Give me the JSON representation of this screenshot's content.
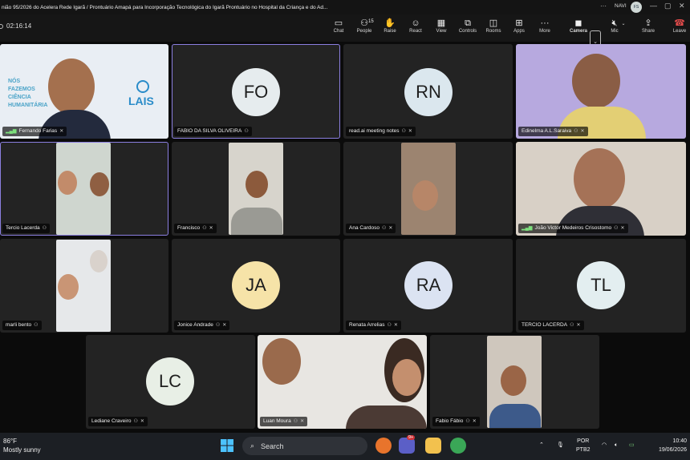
{
  "window": {
    "title": "nião 95/2026 do Acelera Rede Igarã / Prontuário Amapá para Incorporação Tecnológica do Igarã Prontuário no Hospital da Criança e do Ad...",
    "user_name": "NAVI",
    "avatar_initials": "FS"
  },
  "toolbar": {
    "timer": "02:16:14",
    "chat": "Chat",
    "people": "People",
    "people_count": "15",
    "raise": "Raise",
    "react": "React",
    "view": "View",
    "controls": "Controls",
    "rooms": "Rooms",
    "apps": "Apps",
    "more": "More",
    "camera": "Camera",
    "mic": "Mic",
    "share": "Share",
    "leave": "Leave"
  },
  "participants": [
    {
      "name": "Fernando Farias",
      "initials": "",
      "banner_lines": [
        "NÓS",
        "FAZEMOS",
        "CIÊNCIA",
        "HUMANITÁRIA"
      ],
      "logo": "LAIS"
    },
    {
      "name": "FABIO DA SILVA OLIVEIRA",
      "initials": "FO"
    },
    {
      "name": "read.ai meeting notes",
      "initials": "RN"
    },
    {
      "name": "Edinelma A.L.Saraiva",
      "initials": ""
    },
    {
      "name": "Tercio Lacerda",
      "initials": ""
    },
    {
      "name": "Francisco",
      "initials": ""
    },
    {
      "name": "Ana Cardoso",
      "initials": ""
    },
    {
      "name": "João Victor Medeiros Crisostomo",
      "initials": ""
    },
    {
      "name": "marli bento",
      "initials": ""
    },
    {
      "name": "Jonice Andrade",
      "initials": "JA"
    },
    {
      "name": "Renata Arrelias",
      "initials": "RA"
    },
    {
      "name": "TERCIO LACERDA",
      "initials": "TL"
    },
    {
      "name": "Lediane Craveiro",
      "initials": "LC"
    },
    {
      "name": "Luan Moura",
      "initials": ""
    },
    {
      "name": "Fabio Fábio",
      "initials": ""
    }
  ],
  "avatar_colors": {
    "FO": "#e6ecee",
    "RN": "#dbe7ee",
    "JA": "#f6e3a8",
    "RA": "#dbe3f2",
    "TL": "#e3eef0",
    "LC": "#e8efe6"
  },
  "taskbar": {
    "temperature": "86°F",
    "weather": "Mostly sunny",
    "search_placeholder": "Search",
    "lang_top": "POR",
    "lang_bottom": "PTB2",
    "time": "10:40",
    "date": "19/06/2026",
    "teams_badge": "9+"
  }
}
